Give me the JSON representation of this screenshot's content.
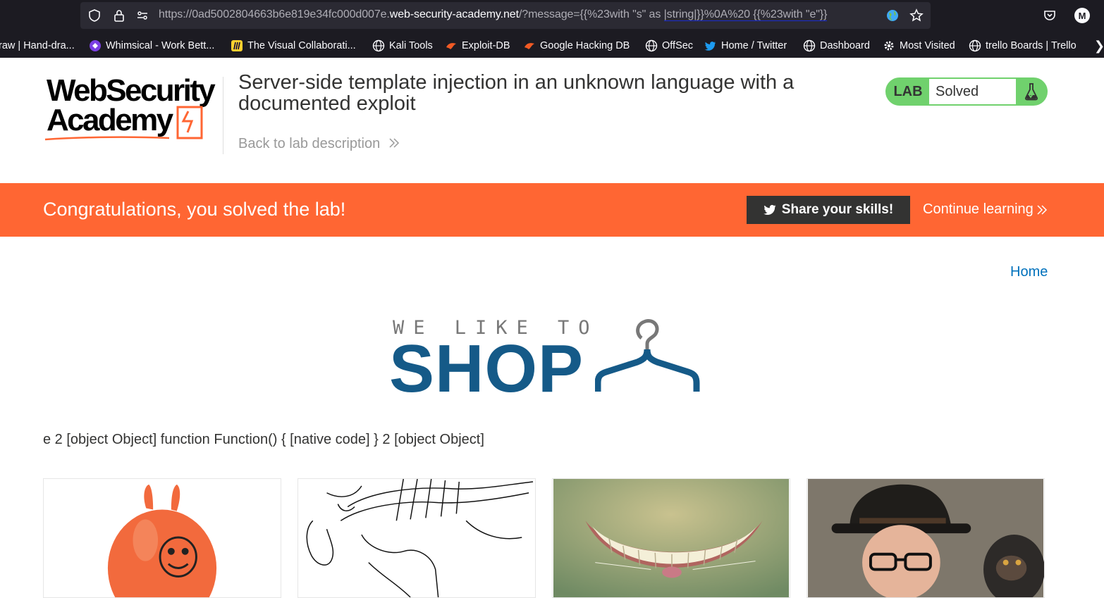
{
  "browser": {
    "url_prefix": "https://0ad5002804663b6e819e34fc000d007e.",
    "url_host": "web-security-academy.net",
    "url_path": "/?message={{%23with \"s\" as ",
    "url_highlight": "|string|}}%0A%20 {{%23with \"e\"}}",
    "bookmarks": [
      {
        "label": "raw | Hand-dra...",
        "icon": "none"
      },
      {
        "label": "Whimsical - Work Bett...",
        "icon": "whimsical-icon"
      },
      {
        "label": "The Visual Collaborati...",
        "icon": "miro-icon"
      },
      {
        "label": "Kali Tools",
        "icon": "globe-icon"
      },
      {
        "label": "Exploit-DB",
        "icon": "exploitdb-icon"
      },
      {
        "label": "Google Hacking DB",
        "icon": "exploitdb-icon"
      },
      {
        "label": "OffSec",
        "icon": "globe-icon"
      },
      {
        "label": "Home / Twitter",
        "icon": "twitter-icon"
      },
      {
        "label": "Dashboard",
        "icon": "globe-icon"
      },
      {
        "label": "Most Visited",
        "icon": "gear-icon"
      },
      {
        "label": "trello  Boards | Trello",
        "icon": "globe-icon"
      }
    ],
    "profile_initial": "M"
  },
  "header": {
    "logo_line1": "WebSecurity",
    "logo_line2": "Academy",
    "lab_title": "Server-side template injection in an unknown language with a documented exploit",
    "back_link": "Back to lab description",
    "lab_badge": "LAB",
    "lab_state": "Solved"
  },
  "banner": {
    "message": "Congratulations, you solved the lab!",
    "share_button": "Share your skills!",
    "continue_link": "Continue learning"
  },
  "shop": {
    "home_link": "Home",
    "tagline": "WE LIKE TO",
    "name": "SHOP",
    "message_output": "e 2 [object Object] function Function() { [native code] } 2 [object Object]"
  },
  "products": [
    {
      "image": "space-hopper"
    },
    {
      "image": "sketch-drawing"
    },
    {
      "image": "cheshire-grin"
    },
    {
      "image": "man-with-monkey"
    }
  ],
  "colors": {
    "brand_orange": "#ff6633",
    "solved_green": "#70d16d",
    "shop_blue": "#155a88",
    "link_blue": "#0071bc"
  }
}
